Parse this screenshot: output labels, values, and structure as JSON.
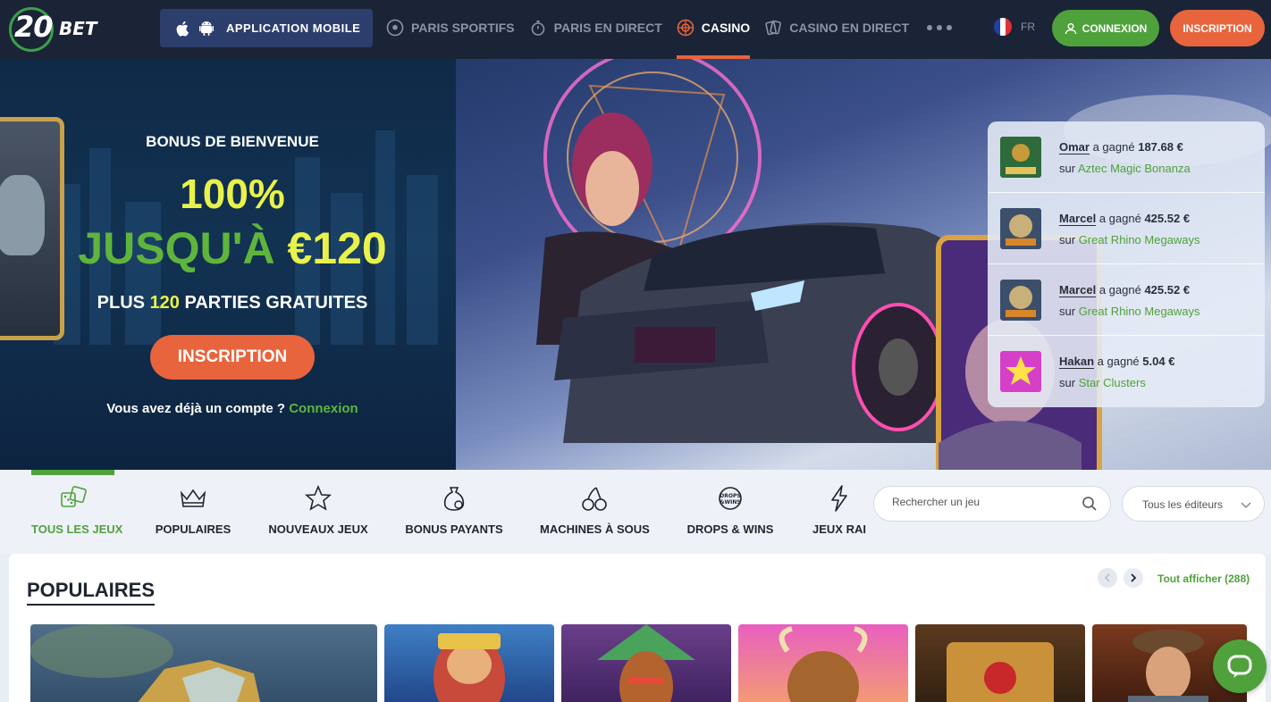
{
  "header": {
    "logo_number": "20",
    "logo_word": "BET",
    "app_button_label": "APPLICATION MOBILE",
    "nav": [
      {
        "label": "PARIS SPORTIFS",
        "icon": "football-icon"
      },
      {
        "label": "PARIS EN DIRECT",
        "icon": "stopwatch-icon"
      },
      {
        "label": "CASINO",
        "icon": "roulette-icon",
        "active": true
      },
      {
        "label": "CASINO EN DIRECT",
        "icon": "cards-icon"
      }
    ],
    "more_icon": "more-dots-icon",
    "language": "FR",
    "login_label": "CONNEXION",
    "signup_label": "INSCRIPTION"
  },
  "hero": {
    "bonus_title": "BONUS DE BIENVENUE",
    "bonus_percent": "100%",
    "bonus_amount_prefix": "JUSQU'À",
    "bonus_amount_value": "€120",
    "free_spins_prefix": "PLUS",
    "free_spins_count": "120",
    "free_spins_suffix": "PARTIES GRATUITES",
    "cta_label": "INSCRIPTION",
    "account_question": "Vous avez déjà un compte ?",
    "account_link": "Connexion"
  },
  "wins": [
    {
      "name": "Omar",
      "verb": "a gagné",
      "amount": "187.68 €",
      "prefix": "sur",
      "game": "Aztec Magic Bonanza"
    },
    {
      "name": "Marcel",
      "verb": "a gagné",
      "amount": "425.52 €",
      "prefix": "sur",
      "game": "Great Rhino Megaways"
    },
    {
      "name": "Marcel",
      "verb": "a gagné",
      "amount": "425.52 €",
      "prefix": "sur",
      "game": "Great Rhino Megaways"
    },
    {
      "name": "Hakan",
      "verb": "a gagné",
      "amount": "5.04 €",
      "prefix": "sur",
      "game": "Star Clusters"
    }
  ],
  "categories": [
    {
      "label": "TOUS LES JEUX",
      "icon": "dice-icon",
      "active": true
    },
    {
      "label": "POPULAIRES",
      "icon": "crown-icon"
    },
    {
      "label": "NOUVEAUX JEUX",
      "icon": "star-icon"
    },
    {
      "label": "BONUS PAYANTS",
      "icon": "money-bag-icon"
    },
    {
      "label": "MACHINES À SOUS",
      "icon": "cherries-icon"
    },
    {
      "label": "DROPS & WINS",
      "icon": "drops-wins-icon"
    },
    {
      "label": "JEUX RAI",
      "icon": "lightning-icon"
    }
  ],
  "search": {
    "placeholder": "Rechercher un jeu"
  },
  "providers": {
    "label": "Tous les éditeurs"
  },
  "popular": {
    "title": "POPULAIRES",
    "see_all": "Tout afficher (288)"
  },
  "colors": {
    "header_bg": "#1b2436",
    "accent_green": "#4fa23b",
    "accent_orange": "#e8643c",
    "bonus_yellow": "#e9f24a"
  }
}
